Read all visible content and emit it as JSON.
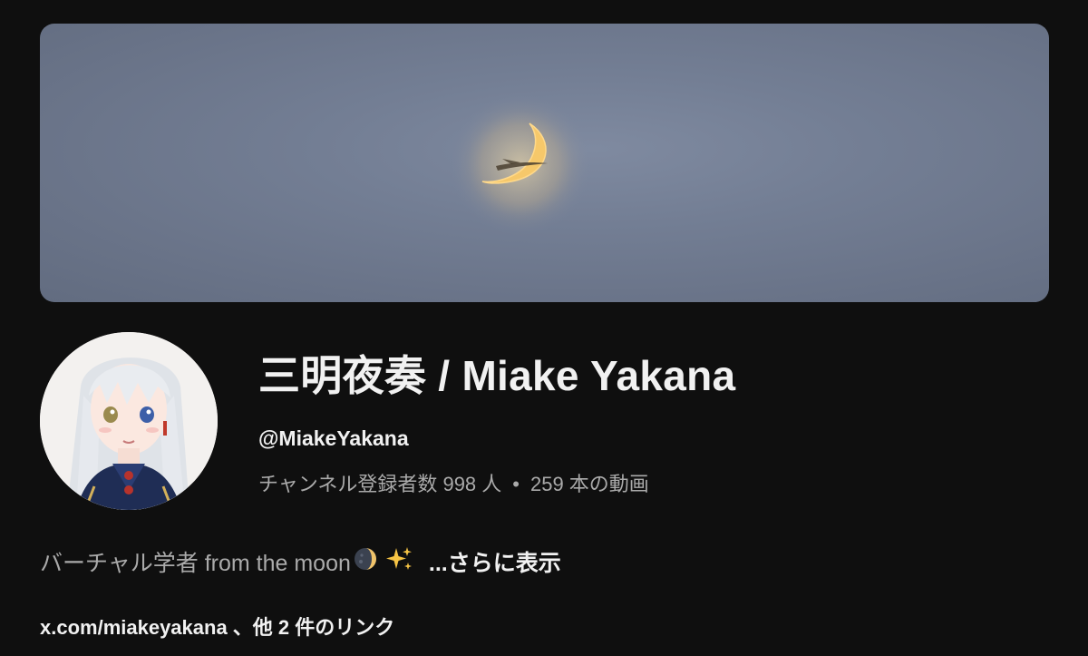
{
  "channel": {
    "name": "三明夜奏 / Miake Yakana",
    "handle": "@MiakeYakana",
    "subscribers": "チャンネル登録者数 998 人",
    "separator": "•",
    "videos": "259 本の動画"
  },
  "description": {
    "text": "バーチャル学者 from the moon",
    "emojis": [
      "moon-emoji",
      "sparkles-emoji"
    ],
    "more_label": "...さらに表示"
  },
  "links": {
    "label": "x.com/miakeyakana 、他 2 件のリンク"
  },
  "colors": {
    "background": "#0f0f0f",
    "primary_text": "#f1f1f1",
    "secondary_text": "#aaaaaa",
    "banner_sky": "#737e94",
    "moon_glow": "#f0c36a"
  }
}
